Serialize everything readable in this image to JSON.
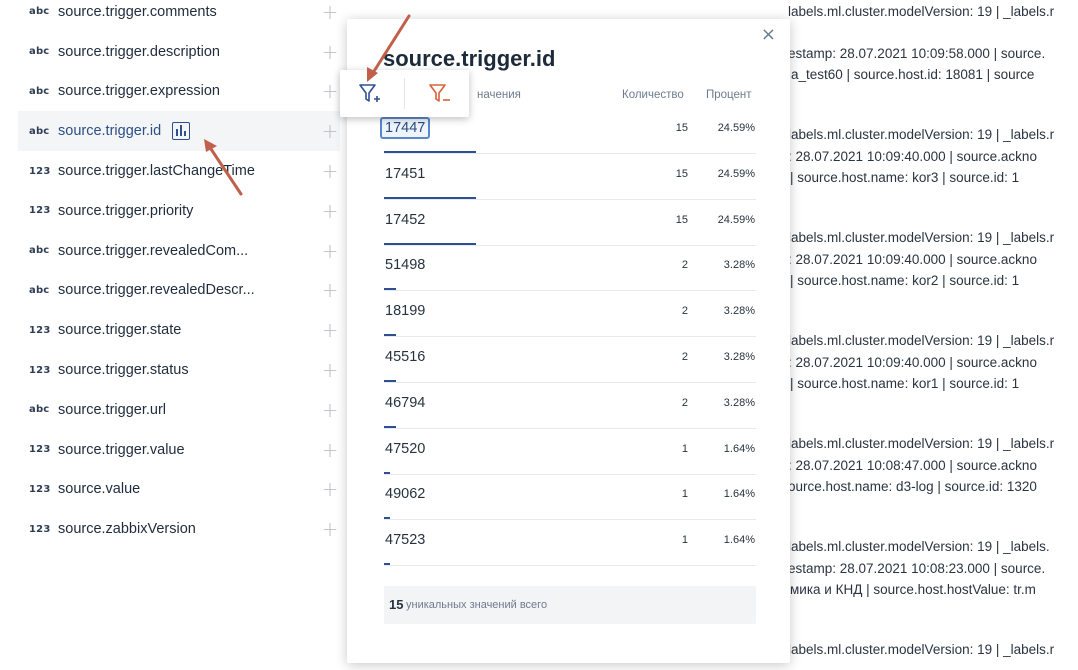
{
  "fields": [
    {
      "type": "abc",
      "name": "source.trigger.comments"
    },
    {
      "type": "abc",
      "name": "source.trigger.description"
    },
    {
      "type": "abc",
      "name": "source.trigger.expression"
    },
    {
      "type": "abc",
      "name": "source.trigger.id"
    },
    {
      "type": "123",
      "name": "source.trigger.lastChangeTime"
    },
    {
      "type": "123",
      "name": "source.trigger.priority"
    },
    {
      "type": "abc",
      "name": "source.trigger.revealedCom..."
    },
    {
      "type": "abc",
      "name": "source.trigger.revealedDescr..."
    },
    {
      "type": "123",
      "name": "source.trigger.state"
    },
    {
      "type": "123",
      "name": "source.trigger.status"
    },
    {
      "type": "abc",
      "name": "source.trigger.url"
    },
    {
      "type": "123",
      "name": "source.trigger.value"
    },
    {
      "type": "123",
      "name": "source.value"
    },
    {
      "type": "123",
      "name": "source.zabbixVersion"
    }
  ],
  "field_plus": "+",
  "popup": {
    "title": "source.trigger.id",
    "close": "×",
    "col_value": "Значения",
    "col_value_visible": "начения",
    "col_count": "Количество",
    "col_percent": "Процент",
    "rows": [
      {
        "value": "17447",
        "count": "15",
        "percent": "24.59%",
        "share": 0.2459
      },
      {
        "value": "17451",
        "count": "15",
        "percent": "24.59%",
        "share": 0.2459
      },
      {
        "value": "17452",
        "count": "15",
        "percent": "24.59%",
        "share": 0.2459
      },
      {
        "value": "51498",
        "count": "2",
        "percent": "3.28%",
        "share": 0.0328
      },
      {
        "value": "18199",
        "count": "2",
        "percent": "3.28%",
        "share": 0.0328
      },
      {
        "value": "45516",
        "count": "2",
        "percent": "3.28%",
        "share": 0.0328
      },
      {
        "value": "46794",
        "count": "2",
        "percent": "3.28%",
        "share": 0.0328
      },
      {
        "value": "47520",
        "count": "1",
        "percent": "1.64%",
        "share": 0.0164
      },
      {
        "value": "49062",
        "count": "1",
        "percent": "1.64%",
        "share": 0.0164
      },
      {
        "value": "47523",
        "count": "1",
        "percent": "1.64%",
        "share": 0.0164
      }
    ],
    "footer_count": "15",
    "footer_text": "уникальных значений всего"
  },
  "filter_toolbar": {
    "include_icon": "filter-plus-icon",
    "exclude_icon": "filter-minus-icon"
  },
  "log_lines": [
    "labels.ml.cluster.modelVersion: 19  |  _labels.r",
    "estamp: 28.07.2021 10:09:58.000  |  source.",
    "a_test60  |  source.host.id: 18081  |  source",
    "labels.ml.cluster.modelVersion: 19  |  _labels.r",
    ": 28.07.2021 10:09:40.000  |  source.ackno",
    "  |  source.host.name: kor3  |  source.id: 1",
    "labels.ml.cluster.modelVersion: 19  |  _labels.r",
    ": 28.07.2021 10:09:40.000  |  source.ackno",
    "  |  source.host.name: kor2  |  source.id: 1",
    "labels.ml.cluster.modelVersion: 19  |  _labels.r",
    ": 28.07.2021 10:09:40.000  |  source.ackno",
    "  |  source.host.name: kor1  |  source.id: 1",
    "labels.ml.cluster.modelVersion: 19  |  _labels.r",
    ": 28.07.2021 10:08:47.000  |  source.ackno",
    "ource.host.name: d3-log  |  source.id: 1320",
    "labels.ml.cluster.modelVersion: 19  |  _labels.",
    "estamp: 28.07.2021 10:08:23.000  |  source.",
    "мика и КНД  |  source.host.hostValue: tr.m",
    "labels.ml.cluster.modelVersion: 19  |  _labels.r"
  ],
  "colors": {
    "accent": "#2e5090",
    "annotation_arrow": "#c0604a",
    "filter_include": "#2e5090",
    "filter_exclude": "#d9603a"
  }
}
